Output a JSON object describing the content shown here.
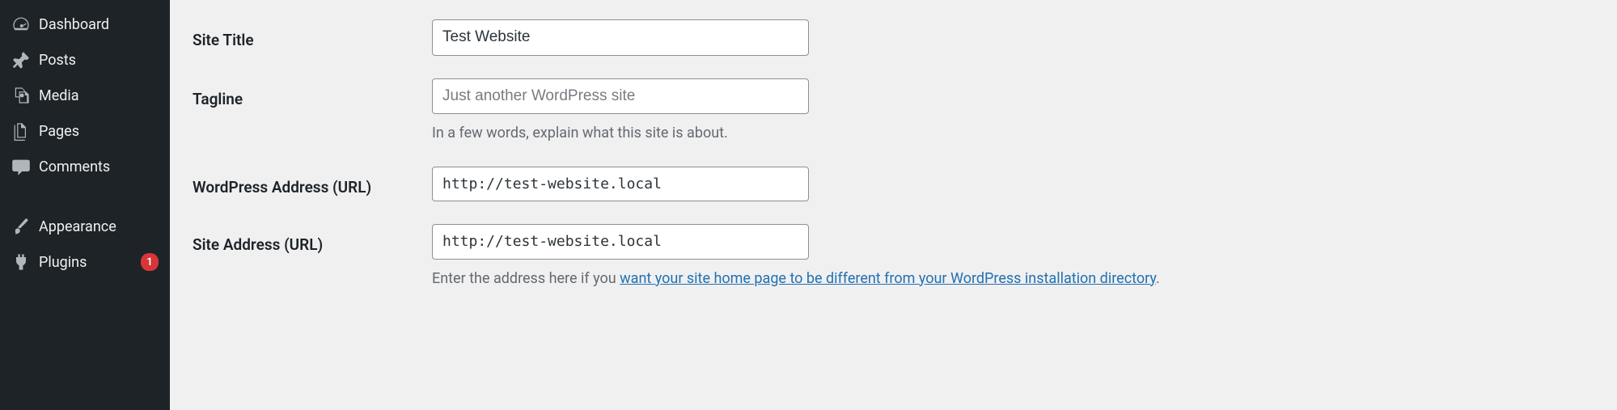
{
  "sidebar": {
    "items": [
      {
        "label": "Dashboard",
        "icon": "dashboard-icon"
      },
      {
        "label": "Posts",
        "icon": "pin-icon"
      },
      {
        "label": "Media",
        "icon": "media-icon"
      },
      {
        "label": "Pages",
        "icon": "pages-icon"
      },
      {
        "label": "Comments",
        "icon": "comment-icon"
      },
      {
        "label": "Appearance",
        "icon": "brush-icon"
      },
      {
        "label": "Plugins",
        "icon": "plug-icon",
        "badge": "1"
      }
    ]
  },
  "settings": {
    "site_title": {
      "label": "Site Title",
      "value": "Test Website"
    },
    "tagline": {
      "label": "Tagline",
      "placeholder": "Just another WordPress site",
      "description": "In a few words, explain what this site is about."
    },
    "wp_address": {
      "label": "WordPress Address (URL)",
      "value": "http://test-website.local"
    },
    "site_address": {
      "label": "Site Address (URL)",
      "value": "http://test-website.local",
      "description_prefix": "Enter the address here if you ",
      "description_link": "want your site home page to be different from your WordPress installation directory",
      "description_suffix": "."
    }
  }
}
